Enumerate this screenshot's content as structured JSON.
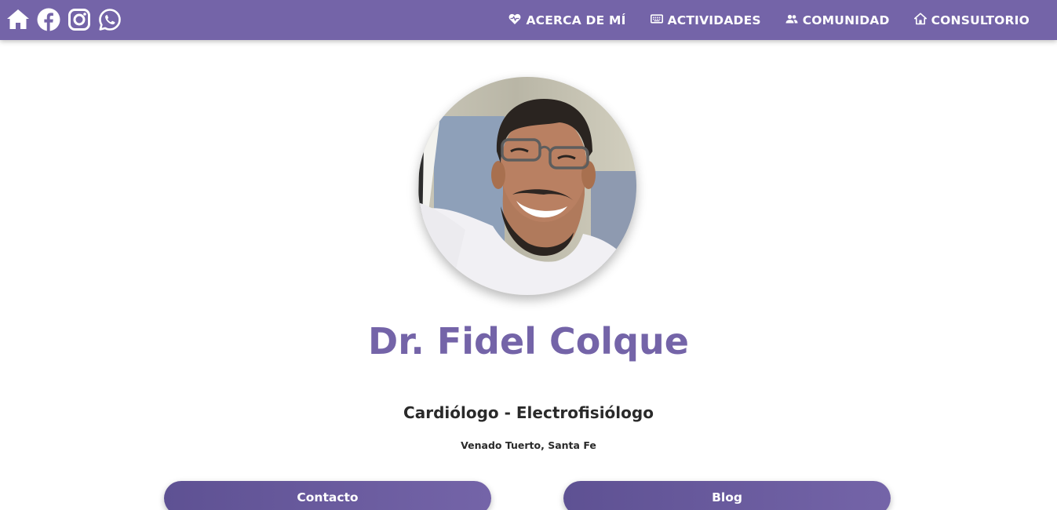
{
  "header": {
    "social_icons": [
      {
        "name": "home-icon"
      },
      {
        "name": "facebook-icon"
      },
      {
        "name": "instagram-icon"
      },
      {
        "name": "whatsapp-icon"
      }
    ],
    "nav": [
      {
        "label": "ACERCA DE MÍ",
        "icon": "heart-pulse-icon"
      },
      {
        "label": "ACTIVIDADES",
        "icon": "keyboard-icon"
      },
      {
        "label": "COMUNIDAD",
        "icon": "people-icon"
      },
      {
        "label": "CONSULTORIO",
        "icon": "house-icon"
      }
    ]
  },
  "profile": {
    "name": "Dr. Fidel Colque",
    "specialty": "Cardiólogo - Electrofisiólogo",
    "location": "Venado Tuerto, Santa Fe"
  },
  "actions": {
    "contact_label": "Contacto",
    "blog_label": "Blog"
  },
  "colors": {
    "primary": "#7464a8",
    "text": "#2a2a2a",
    "background": "#ffffff"
  }
}
